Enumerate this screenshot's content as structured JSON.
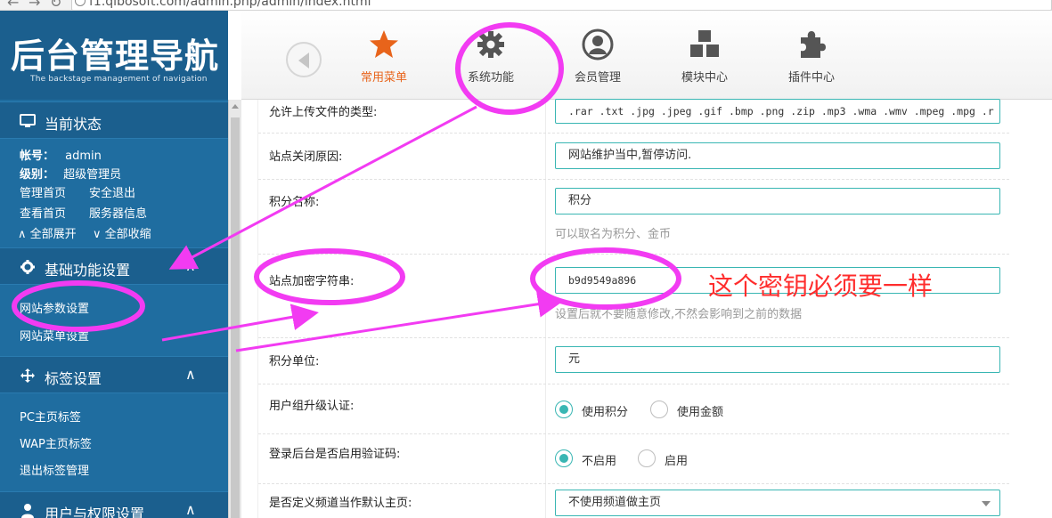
{
  "browser": {
    "url": "f1.qibosoft.com/admin.php/admin/index.html"
  },
  "sidebar": {
    "logo_title": "后台管理导航",
    "logo_subtitle": "The backstage management of navigation",
    "status_section": {
      "title": "当前状态",
      "account_label": "帐号：",
      "account_value": "admin",
      "level_label": "级别：",
      "level_value": "超级管理员",
      "links": [
        "管理首页",
        "安全退出",
        "查看首页",
        "服务器信息"
      ],
      "expand_all": "全部展开",
      "collapse_all": "全部收缩"
    },
    "sections": [
      {
        "title": "基础功能设置",
        "items": [
          "网站参数设置",
          "网站菜单设置"
        ]
      },
      {
        "title": "标签设置",
        "items": [
          "PC主页标签",
          "WAP主页标签",
          "退出标签管理"
        ]
      },
      {
        "title": "用户与权限设置",
        "items": []
      }
    ]
  },
  "topbar": {
    "items": [
      {
        "label": "常用菜单",
        "icon": "star-icon",
        "active": true
      },
      {
        "label": "系统功能",
        "icon": "gear-icon",
        "active": false
      },
      {
        "label": "会员管理",
        "icon": "user-icon",
        "active": false
      },
      {
        "label": "模块中心",
        "icon": "cubes-icon",
        "active": false
      },
      {
        "label": "插件中心",
        "icon": "puzzle-icon",
        "active": false
      }
    ]
  },
  "form": {
    "upload_types": {
      "label": "允许上传文件的类型:",
      "value": ".rar .txt .jpg .jpeg .gif .bmp .png .zip .mp3 .wma .wmv .mpeg .mpg .r"
    },
    "close_reason": {
      "label": "站点关闭原因:",
      "value": "网站维护当中,暂停访问."
    },
    "points_name": {
      "label": "积分名称:",
      "value": "积分",
      "hint": "可以取名为积分、金币"
    },
    "encrypt_key": {
      "label": "站点加密字符串:",
      "value": "b9d9549a896",
      "hint": "设置后就不要随意修改,不然会影响到之前的数据"
    },
    "points_unit": {
      "label": "积分单位:",
      "value": "元"
    },
    "group_upgrade": {
      "label": "用户组升级认证:",
      "options": [
        "使用积分",
        "使用金额"
      ],
      "selected": "使用积分"
    },
    "admin_captcha": {
      "label": "登录后台是否启用验证码:",
      "options": [
        "不启用",
        "启用"
      ],
      "selected": "不启用"
    },
    "default_channel": {
      "label": "是否定义频道当作默认主页:",
      "value": "不使用频道做主页"
    }
  },
  "annotation": {
    "text": "这个密钥必须要一样",
    "color": "#ff2d2d",
    "marker_color": "#f23bf2"
  },
  "colors": {
    "sidebar": "#1f6da0",
    "sidebar_header": "#1b5f8e",
    "accent_orange": "#e8641b",
    "input_border": "#39b6b3"
  }
}
